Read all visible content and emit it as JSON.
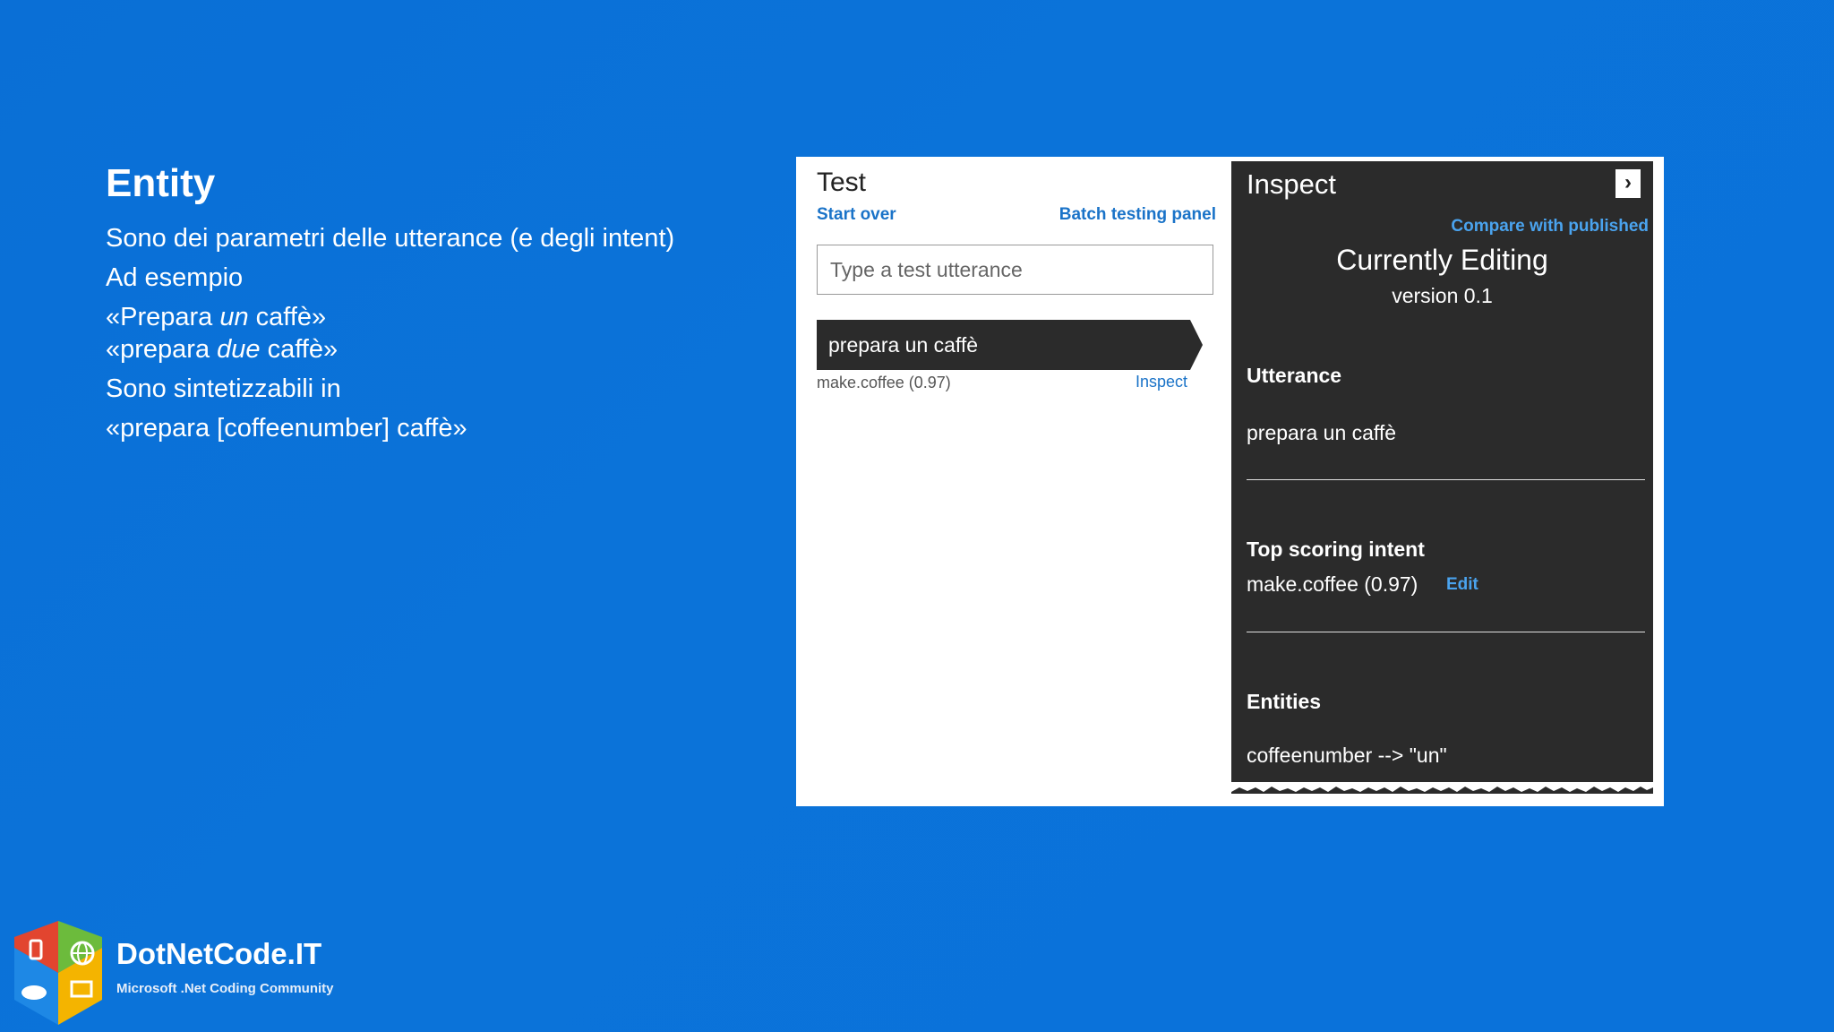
{
  "slide": {
    "title": "Entity",
    "lines": {
      "l1": "Sono dei parametri delle utterance (e degli intent)",
      "l2": "Ad esempio",
      "l3_pre": "«Prepara ",
      "l3_em": "un",
      "l3_post": " caffè»",
      "l4_pre": "«prepara ",
      "l4_em": "due",
      "l4_post": " caffè»",
      "l5": "Sono sintetizzabili in",
      "l6": "«prepara [coffeenumber] caffè»"
    }
  },
  "test_pane": {
    "title": "Test",
    "start_over": "Start over",
    "batch_testing": "Batch testing panel",
    "input_placeholder": "Type a test utterance",
    "result_utterance": "prepara un caffè",
    "result_score": "make.coffee (0.97)",
    "inspect_link": "Inspect"
  },
  "inspect_pane": {
    "title": "Inspect",
    "close_icon": "chevron-right-icon",
    "compare_link": "Compare with published",
    "editing_title": "Currently Editing",
    "editing_version": "version 0.1",
    "utterance_head": "Utterance",
    "utterance_value": "prepara un caffè",
    "intent_head": "Top scoring intent",
    "intent_value": "make.coffee (0.97)",
    "edit_link": "Edit",
    "entities_head": "Entities",
    "entities_value": "coffeenumber --> \"un\""
  },
  "brand": {
    "name": "DotNetCode.IT",
    "subtitle": "Microsoft .Net Coding Community"
  },
  "colors": {
    "background": "#0b73d9",
    "link": "#1a73c8",
    "inspect_bg": "#2b2b2b",
    "logo_red": "#e2452f",
    "logo_green": "#6cbb3c",
    "logo_blue": "#1e88e5",
    "logo_yellow": "#f4b400"
  }
}
